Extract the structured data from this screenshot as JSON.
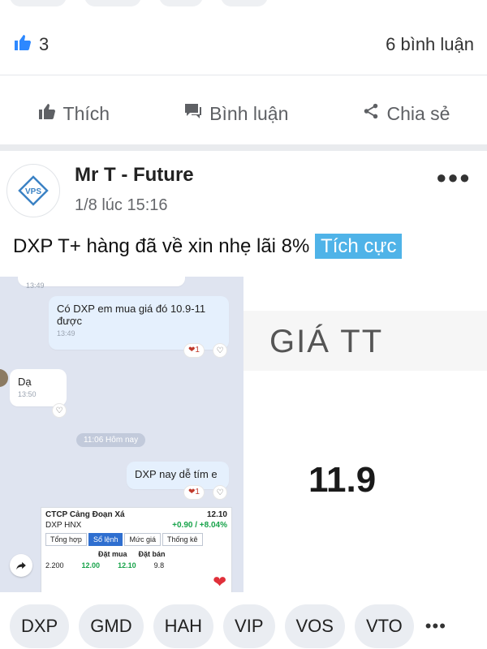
{
  "reactions": {
    "like_count": "3",
    "comments_count": "6 bình luận"
  },
  "actions": {
    "like": "Thích",
    "comment": "Bình luận",
    "share": "Chia sẻ"
  },
  "post": {
    "author": "Mr T - Future",
    "time": "1/8 lúc 15:16",
    "text": "DXP T+ hàng đã về xin nhẹ lãi 8%",
    "sentiment_tag": "Tích cực",
    "avatar_label": "VPS"
  },
  "chat": {
    "t0": "13:49",
    "msg1": "Có DXP em mua giá đó 10.9-11 được",
    "msg1_time": "13:49",
    "msg1_react": "1",
    "msg2": "Dạ",
    "msg2_time": "13:50",
    "divider": "11:06 Hôm nay",
    "msg3": "DXP nay dễ tím e",
    "msg3_react": "1",
    "stock": {
      "name": "CTCP Cảng Đoạn Xá",
      "price": "12.10",
      "ticker": "DXP HNX",
      "change": "+0.90 / +8.04%",
      "tabs": [
        "Tổng hợp",
        "Sổ lệnh",
        "Mức giá",
        "Thống kê"
      ],
      "col_buy": "Đặt mua",
      "col_sell": "Đặt bán",
      "row_vol": "2.200",
      "row_buy": "12.00",
      "row_sell": "12.10",
      "row_vol2": "9.8"
    }
  },
  "price_panel": {
    "label": "GIÁ TT",
    "value": "11.9"
  },
  "tags": [
    "DXP",
    "GMD",
    "HAH",
    "VIP",
    "VOS",
    "VTO"
  ],
  "colors": {
    "sentiment_bg": "#4fb3e8",
    "like_icon": "#2d88ff",
    "heart": "#e0303a"
  }
}
